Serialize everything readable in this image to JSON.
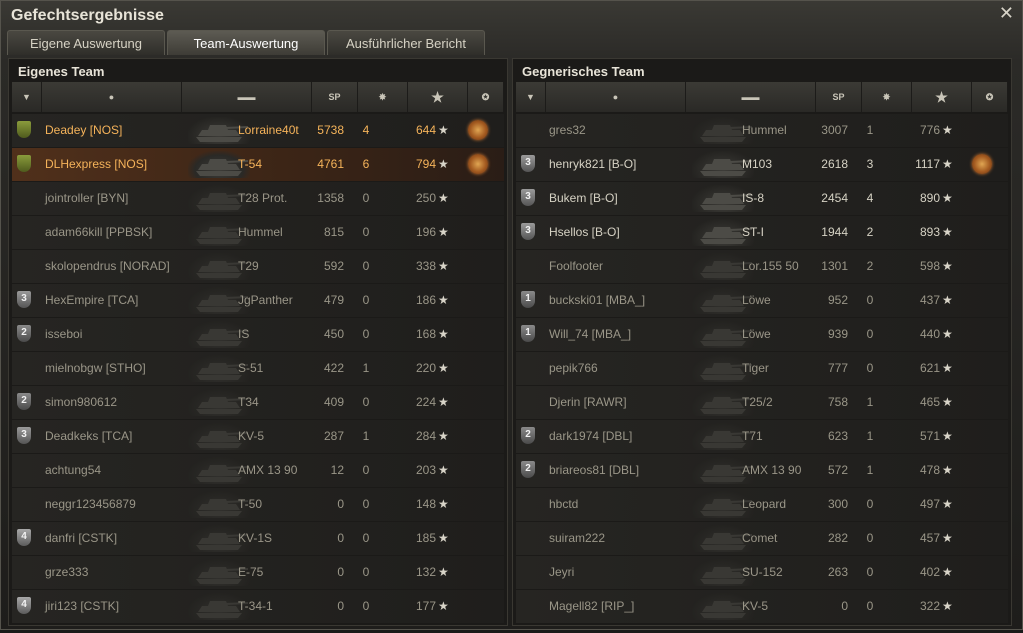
{
  "window": {
    "title": "Gefechtsergebnisse"
  },
  "tabs": [
    {
      "label": "Eigene Auswertung"
    },
    {
      "label": "Team-Auswertung"
    },
    {
      "label": "Ausführlicher Bericht"
    }
  ],
  "headers": {
    "xp": "SP"
  },
  "own_team": {
    "title": "Eigenes Team",
    "rows": [
      {
        "badge": "",
        "badge_class": "b1",
        "name": "Deadey [NOS]",
        "tank": "Lorraine40t",
        "xp": "5738",
        "kills": "4",
        "score": "644",
        "medal": true,
        "state": "self"
      },
      {
        "badge": "",
        "badge_class": "b1",
        "name": "DLHexpress [NOS]",
        "tank": "T-54",
        "xp": "4761",
        "kills": "6",
        "score": "794",
        "medal": true,
        "state": "self hl"
      },
      {
        "badge": "",
        "badge_class": "",
        "name": "jointroller [BYN]",
        "tank": "T28 Prot.",
        "xp": "1358",
        "kills": "0",
        "score": "250",
        "medal": false,
        "state": "dead"
      },
      {
        "badge": "",
        "badge_class": "",
        "name": "adam66kill [PPBSK]",
        "tank": "Hummel",
        "xp": "815",
        "kills": "0",
        "score": "196",
        "medal": false,
        "state": "dead"
      },
      {
        "badge": "",
        "badge_class": "",
        "name": "skolopendrus [NORAD]",
        "tank": "T29",
        "xp": "592",
        "kills": "0",
        "score": "338",
        "medal": false,
        "state": "dead"
      },
      {
        "badge": "3",
        "badge_class": "b3",
        "name": "HexEmpire [TCA]",
        "tank": "JgPanther",
        "xp": "479",
        "kills": "0",
        "score": "186",
        "medal": false,
        "state": "dead"
      },
      {
        "badge": "2",
        "badge_class": "b2",
        "name": "isseboi",
        "tank": "IS",
        "xp": "450",
        "kills": "0",
        "score": "168",
        "medal": false,
        "state": "dead"
      },
      {
        "badge": "",
        "badge_class": "",
        "name": "mielnobgw [STHO]",
        "tank": "S-51",
        "xp": "422",
        "kills": "1",
        "score": "220",
        "medal": false,
        "state": "dead"
      },
      {
        "badge": "2",
        "badge_class": "b2",
        "name": "simon980612",
        "tank": "T34",
        "xp": "409",
        "kills": "0",
        "score": "224",
        "medal": false,
        "state": "dead"
      },
      {
        "badge": "3",
        "badge_class": "b3",
        "name": "Deadkeks [TCA]",
        "tank": "KV-5",
        "xp": "287",
        "kills": "1",
        "score": "284",
        "medal": false,
        "state": "dead"
      },
      {
        "badge": "",
        "badge_class": "",
        "name": "achtung54",
        "tank": "AMX 13 90",
        "xp": "12",
        "kills": "0",
        "score": "203",
        "medal": false,
        "state": "dead"
      },
      {
        "badge": "",
        "badge_class": "",
        "name": "neggr123456879",
        "tank": "T-50",
        "xp": "0",
        "kills": "0",
        "score": "148",
        "medal": false,
        "state": "dead"
      },
      {
        "badge": "4",
        "badge_class": "b4",
        "name": "danfri [CSTK]",
        "tank": "KV-1S",
        "xp": "0",
        "kills": "0",
        "score": "185",
        "medal": false,
        "state": "dead"
      },
      {
        "badge": "",
        "badge_class": "",
        "name": "grze333",
        "tank": "E-75",
        "xp": "0",
        "kills": "0",
        "score": "132",
        "medal": false,
        "state": "dead"
      },
      {
        "badge": "4",
        "badge_class": "b4",
        "name": "jiri123 [CSTK]",
        "tank": "T-34-1",
        "xp": "0",
        "kills": "0",
        "score": "177",
        "medal": false,
        "state": "dead"
      }
    ]
  },
  "enemy_team": {
    "title": "Gegnerisches Team",
    "rows": [
      {
        "badge": "",
        "badge_class": "",
        "name": "gres32",
        "tank": "Hummel",
        "xp": "3007",
        "kills": "1",
        "score": "776",
        "medal": false,
        "state": "dead"
      },
      {
        "badge": "3",
        "badge_class": "b3",
        "name": "henryk821 [B-O]",
        "tank": "M103",
        "xp": "2618",
        "kills": "3",
        "score": "1117",
        "medal": true,
        "state": "alive"
      },
      {
        "badge": "3",
        "badge_class": "b3",
        "name": "Bukem [B-O]",
        "tank": "IS-8",
        "xp": "2454",
        "kills": "4",
        "score": "890",
        "medal": false,
        "state": "alive"
      },
      {
        "badge": "3",
        "badge_class": "b3",
        "name": "Hsellos [B-O]",
        "tank": "ST-I",
        "xp": "1944",
        "kills": "2",
        "score": "893",
        "medal": false,
        "state": "alive"
      },
      {
        "badge": "",
        "badge_class": "",
        "name": "Foolfooter",
        "tank": "Lor.155 50",
        "xp": "1301",
        "kills": "2",
        "score": "598",
        "medal": false,
        "state": "dead"
      },
      {
        "badge": "1",
        "badge_class": "b2",
        "name": "buckski01 [MBA_]",
        "tank": "Löwe",
        "xp": "952",
        "kills": "0",
        "score": "437",
        "medal": false,
        "state": "dead"
      },
      {
        "badge": "1",
        "badge_class": "b2",
        "name": "Will_74 [MBA_]",
        "tank": "Löwe",
        "xp": "939",
        "kills": "0",
        "score": "440",
        "medal": false,
        "state": "dead"
      },
      {
        "badge": "",
        "badge_class": "",
        "name": "pepik766",
        "tank": "Tiger",
        "xp": "777",
        "kills": "0",
        "score": "621",
        "medal": false,
        "state": "dead"
      },
      {
        "badge": "",
        "badge_class": "",
        "name": "Djerin [RAWR]",
        "tank": "T25/2",
        "xp": "758",
        "kills": "1",
        "score": "465",
        "medal": false,
        "state": "dead"
      },
      {
        "badge": "2",
        "badge_class": "b2",
        "name": "dark1974 [DBL]",
        "tank": "T71",
        "xp": "623",
        "kills": "1",
        "score": "571",
        "medal": false,
        "state": "dead"
      },
      {
        "badge": "2",
        "badge_class": "b2",
        "name": "briareos81 [DBL]",
        "tank": "AMX 13 90",
        "xp": "572",
        "kills": "1",
        "score": "478",
        "medal": false,
        "state": "dead"
      },
      {
        "badge": "",
        "badge_class": "",
        "name": "hbctd",
        "tank": "Leopard",
        "xp": "300",
        "kills": "0",
        "score": "497",
        "medal": false,
        "state": "dead"
      },
      {
        "badge": "",
        "badge_class": "",
        "name": "suiram222",
        "tank": "Comet",
        "xp": "282",
        "kills": "0",
        "score": "457",
        "medal": false,
        "state": "dead"
      },
      {
        "badge": "",
        "badge_class": "",
        "name": "Jeyri",
        "tank": "SU-152",
        "xp": "263",
        "kills": "0",
        "score": "402",
        "medal": false,
        "state": "dead"
      },
      {
        "badge": "",
        "badge_class": "",
        "name": "Magell82 [RIP_]",
        "tank": "KV-5",
        "xp": "0",
        "kills": "0",
        "score": "322",
        "medal": false,
        "state": "dead"
      }
    ]
  }
}
